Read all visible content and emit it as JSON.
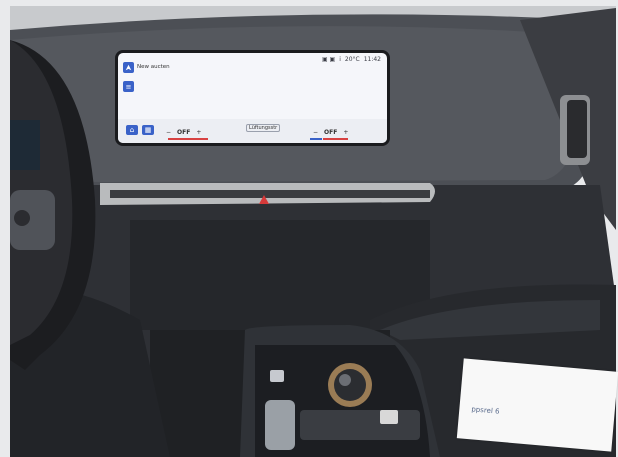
{
  "scene": {
    "description_id": "car-interior-dashboard"
  },
  "infotainment": {
    "status_bar": {
      "signal": "▣ ▣",
      "network": "i",
      "weather": "20°C",
      "time": "11:42"
    },
    "nav_label": "New aucten",
    "bottom": {
      "left_climate_label": "OFF",
      "right_climate_label": "OFF",
      "minus": "−",
      "plus": "+",
      "fan_label": "Lüftungsstr"
    }
  },
  "paper_note": {
    "text": "ppsrel 6"
  },
  "colors": {
    "accent": "#3a62c8",
    "heat": "#d84242",
    "interior_dark": "#2a2c31"
  }
}
